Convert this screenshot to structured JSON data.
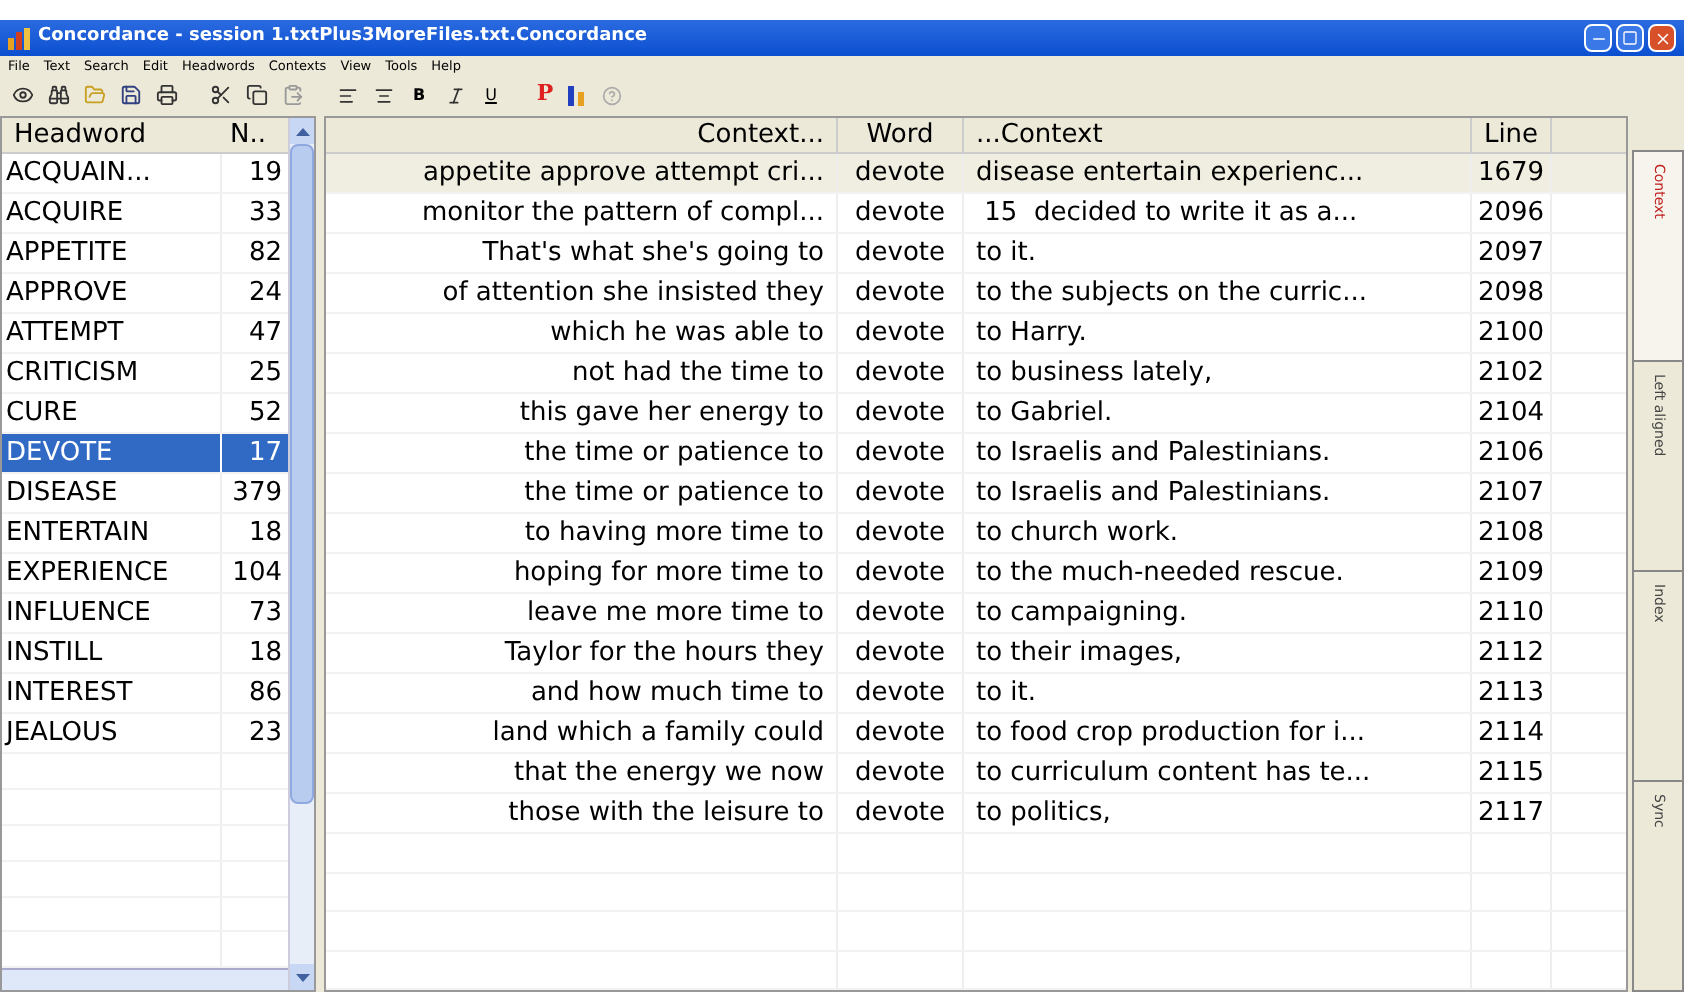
{
  "window": {
    "title": "Concordance - session 1.txtPlus3MoreFiles.txt.Concordance"
  },
  "menu": [
    "File",
    "Text",
    "Search",
    "Edit",
    "Headwords",
    "Contexts",
    "View",
    "Tools",
    "Help"
  ],
  "toolbar": {
    "bold": "B",
    "underline": "U",
    "red_letter": "P"
  },
  "headwords": {
    "columns": [
      "Headword",
      "N.."
    ],
    "rows": [
      {
        "word": "ACQUAIN...",
        "n": "19",
        "selected": false
      },
      {
        "word": "ACQUIRE",
        "n": "33",
        "selected": false
      },
      {
        "word": "APPETITE",
        "n": "82",
        "selected": false
      },
      {
        "word": "APPROVE",
        "n": "24",
        "selected": false
      },
      {
        "word": "ATTEMPT",
        "n": "47",
        "selected": false
      },
      {
        "word": "CRITICISM",
        "n": "25",
        "selected": false
      },
      {
        "word": "CURE",
        "n": "52",
        "selected": false
      },
      {
        "word": "DEVOTE",
        "n": "17",
        "selected": true
      },
      {
        "word": "DISEASE",
        "n": "379",
        "selected": false
      },
      {
        "word": "ENTERTAIN",
        "n": "18",
        "selected": false
      },
      {
        "word": "EXPERIENCE",
        "n": "104",
        "selected": false
      },
      {
        "word": "INFLUENCE",
        "n": "73",
        "selected": false
      },
      {
        "word": "INSTILL",
        "n": "18",
        "selected": false
      },
      {
        "word": "INTEREST",
        "n": "86",
        "selected": false
      },
      {
        "word": "JEALOUS",
        "n": "23",
        "selected": false
      }
    ]
  },
  "concordance": {
    "columns": [
      "Context...",
      "Word",
      "...Context",
      "Line"
    ],
    "rows": [
      {
        "left": "appetite approve attempt cri...",
        "word": "devote",
        "right": "disease entertain experienc...",
        "line": "1679",
        "selected": true
      },
      {
        "left": "monitor the pattern of compl...",
        "word": "devote",
        "right": " 15  decided to write it as a...",
        "line": "2096",
        "selected": false
      },
      {
        "left": "That's what she's going to",
        "word": "devote",
        "right": "to it.",
        "line": "2097",
        "selected": false
      },
      {
        "left": "of attention she insisted they",
        "word": "devote",
        "right": "to the subjects on the curric...",
        "line": "2098",
        "selected": false
      },
      {
        "left": "which he was able to",
        "word": "devote",
        "right": "to Harry.",
        "line": "2100",
        "selected": false
      },
      {
        "left": "not had the time to",
        "word": "devote",
        "right": "to business lately,",
        "line": "2102",
        "selected": false
      },
      {
        "left": "this gave her energy to",
        "word": "devote",
        "right": "to Gabriel.",
        "line": "2104",
        "selected": false
      },
      {
        "left": "the time or patience to",
        "word": "devote",
        "right": "to Israelis and Palestinians.",
        "line": "2106",
        "selected": false
      },
      {
        "left": "the time or patience to",
        "word": "devote",
        "right": "to Israelis and Palestinians.",
        "line": "2107",
        "selected": false
      },
      {
        "left": "to having more time to",
        "word": "devote",
        "right": "to church work.",
        "line": "2108",
        "selected": false
      },
      {
        "left": "hoping for more time to",
        "word": "devote",
        "right": "to the much-needed rescue.",
        "line": "2109",
        "selected": false
      },
      {
        "left": "leave me more time to",
        "word": "devote",
        "right": "to campaigning.",
        "line": "2110",
        "selected": false
      },
      {
        "left": "Taylor for the hours they",
        "word": "devote",
        "right": "to their images,",
        "line": "2112",
        "selected": false
      },
      {
        "left": "and how much time to",
        "word": "devote",
        "right": "to it.",
        "line": "2113",
        "selected": false
      },
      {
        "left": "land which a family could",
        "word": "devote",
        "right": "to food crop production for i...",
        "line": "2114",
        "selected": false
      },
      {
        "left": "that the energy we now",
        "word": "devote",
        "right": "to curriculum content has te...",
        "line": "2115",
        "selected": false
      },
      {
        "left": "those with the leisure to",
        "word": "devote",
        "right": "to politics,",
        "line": "2117",
        "selected": false
      }
    ]
  },
  "side_tabs": [
    {
      "label": "Context",
      "selected": true
    },
    {
      "label": "Left aligned",
      "selected": false
    },
    {
      "label": "Index",
      "selected": false
    },
    {
      "label": "Sync",
      "selected": false
    }
  ]
}
